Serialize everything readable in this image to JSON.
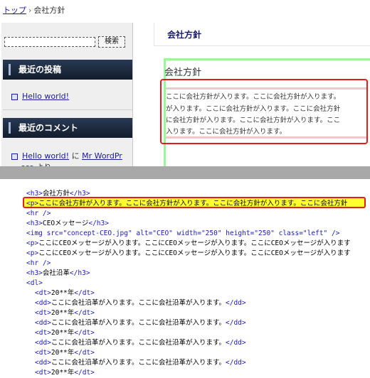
{
  "breadcrumb": {
    "home": "トップ",
    "separator": "›",
    "current": "会社方針"
  },
  "sidebar": {
    "search": {
      "value": "",
      "placeholder": "",
      "button_label": "検索"
    },
    "recent_posts": {
      "heading": "最近の投稿",
      "items": [
        "Hello world!"
      ]
    },
    "recent_comments": {
      "heading": "最近のコメント",
      "item": {
        "post": "Hello world!",
        "connector": "に",
        "author": "Mr WordPr",
        "author_cont": "ess",
        "suffix": "より"
      }
    }
  },
  "content": {
    "heading": "会社方針",
    "article_title": "会社方針",
    "paragraph_lines": [
      "ここに会社方針が入ります。ここに会社方針が入ります。",
      "が入ります。ここに会社方針が入ります。ここに会社方針",
      "に会社方針が入ります。ここに会社方針が入ります。ここ",
      "入ります。ここに会社方針が入ります。"
    ]
  },
  "source": {
    "l1": {
      "o": "<h3>",
      "t": "会社方針",
      "c": "</h3>"
    },
    "l2": {
      "o": "<p>",
      "t": "ここに会社方針が入ります。ここに会社方針が入ります。ここに会社方針が入ります。ここに会社方針"
    },
    "l3": "<hr />",
    "l4": {
      "o": "<h3>",
      "t": "CEOメッセージ",
      "c": "</h3>"
    },
    "l5": "<img src=\"concept-CEO.jpg\" alt=\"CEO\" width=\"250\" height=\"250\" class=\"left\" />",
    "l6": {
      "o": "<p>",
      "t": "ここにCEOメッセージが入ります。ここにCEOメッセージが入ります。ここにCEOメッセージが入ります"
    },
    "l7": {
      "o": "<p>",
      "t": "ここにCEOメッセージが入ります。ここにCEOメッセージが入ります。ここにCEOメッセージが入ります"
    },
    "l8": "<hr />",
    "l9": {
      "o": "<h3>",
      "t": "会社沿革",
      "c": "</h3>"
    },
    "l10": "<dl>",
    "dt_text": "20**年",
    "dd_text": "ここに会社沿革が入ります。ここに会社沿革が入ります。",
    "dt_open": "<dt>",
    "dt_close": "</dt>",
    "dd_open": "<dd>",
    "dd_close": "</dd>"
  },
  "colors": {
    "highlight": "#ffff30",
    "outline": "#e31c1c",
    "sidebar_head": "#1b2638",
    "link": "#1a1a9c",
    "tag": "#1a1aa8"
  }
}
